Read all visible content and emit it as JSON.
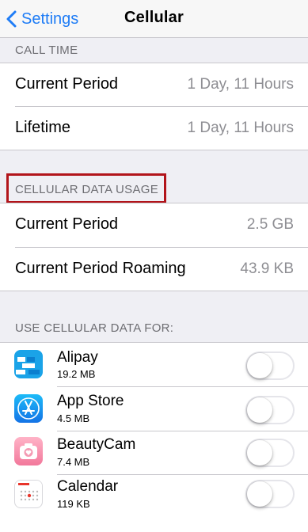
{
  "nav": {
    "back_label": "Settings",
    "title": "Cellular"
  },
  "call_time": {
    "header": "CALL TIME",
    "rows": [
      {
        "label": "Current Period",
        "value": "1 Day, 11 Hours"
      },
      {
        "label": "Lifetime",
        "value": "1 Day, 11 Hours"
      }
    ]
  },
  "cellular_data_usage": {
    "header": "CELLULAR DATA USAGE",
    "rows": [
      {
        "label": "Current Period",
        "value": "2.5 GB"
      },
      {
        "label": "Current Period Roaming",
        "value": "43.9 KB"
      }
    ]
  },
  "use_cellular_data": {
    "header": "USE CELLULAR DATA FOR:",
    "apps": [
      {
        "name": "Alipay",
        "size": "19.2 MB",
        "icon": "alipay-icon",
        "enabled": false
      },
      {
        "name": "App Store",
        "size": "4.5 MB",
        "icon": "app-store-icon",
        "enabled": false
      },
      {
        "name": "BeautyCam",
        "size": "7.4 MB",
        "icon": "beautycam-icon",
        "enabled": false
      },
      {
        "name": "Calendar",
        "size": "119 KB",
        "icon": "calendar-icon",
        "enabled": false
      }
    ]
  },
  "colors": {
    "accent": "#1e7cf6",
    "highlight": "#b2141a",
    "background": "#efeff4"
  }
}
